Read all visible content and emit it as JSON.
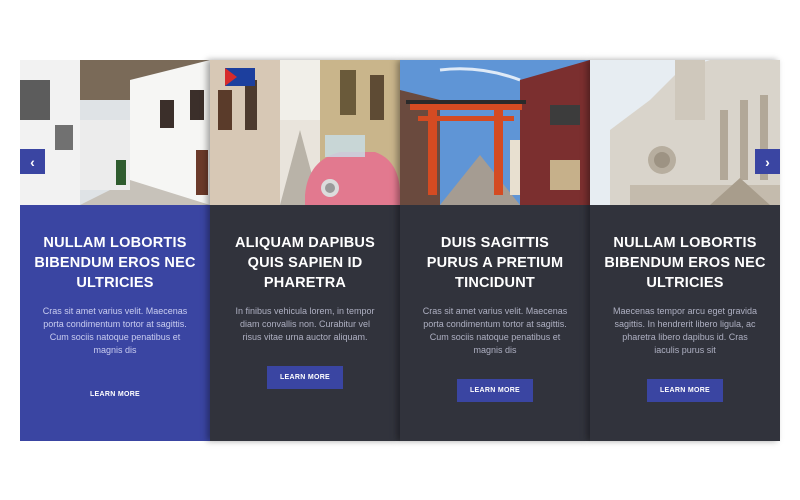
{
  "carousel": {
    "prev_icon": "chevron-left-icon",
    "next_icon": "chevron-right-icon",
    "cards": [
      {
        "image": "whitewashed-village-street",
        "title": "NULLAM LOBORTIS BIBENDUM EROS NEC ULTRICIES",
        "text": "Cras sit amet varius velit. Maecenas porta condimentum tortor at sagittis. Cum sociis natoque penatibus et magnis dis",
        "button": "LEARN MORE"
      },
      {
        "image": "havana-street-pink-car",
        "title": "ALIQUAM DAPIBUS QUIS SAPIEN ID PHARETRA",
        "text": "In finibus vehicula lorem, in tempor diam convallis non. Curabitur vel risus vitae urna auctor aliquam.",
        "button": "LEARN MORE"
      },
      {
        "image": "torii-gate-street",
        "title": "DUIS SAGITTIS PURUS A PRETIUM TINCIDUNT",
        "text": "Cras sit amet varius velit. Maecenas porta condimentum tortor at sagittis. Cum sociis natoque penatibus et magnis dis",
        "button": "LEARN MORE"
      },
      {
        "image": "gothic-cathedral",
        "title": "NULLAM LOBORTIS BIBENDUM EROS NEC ULTRICIES",
        "text": "Maecenas tempor arcu eget gravida sagittis. In hendrerit libero ligula, ac pharetra libero dapibus id. Cras iaculis purus sit",
        "button": "LEARN MORE"
      }
    ]
  },
  "colors": {
    "accent": "#3a45a2",
    "card_dark": "#31333c",
    "background": "#ffffff"
  }
}
